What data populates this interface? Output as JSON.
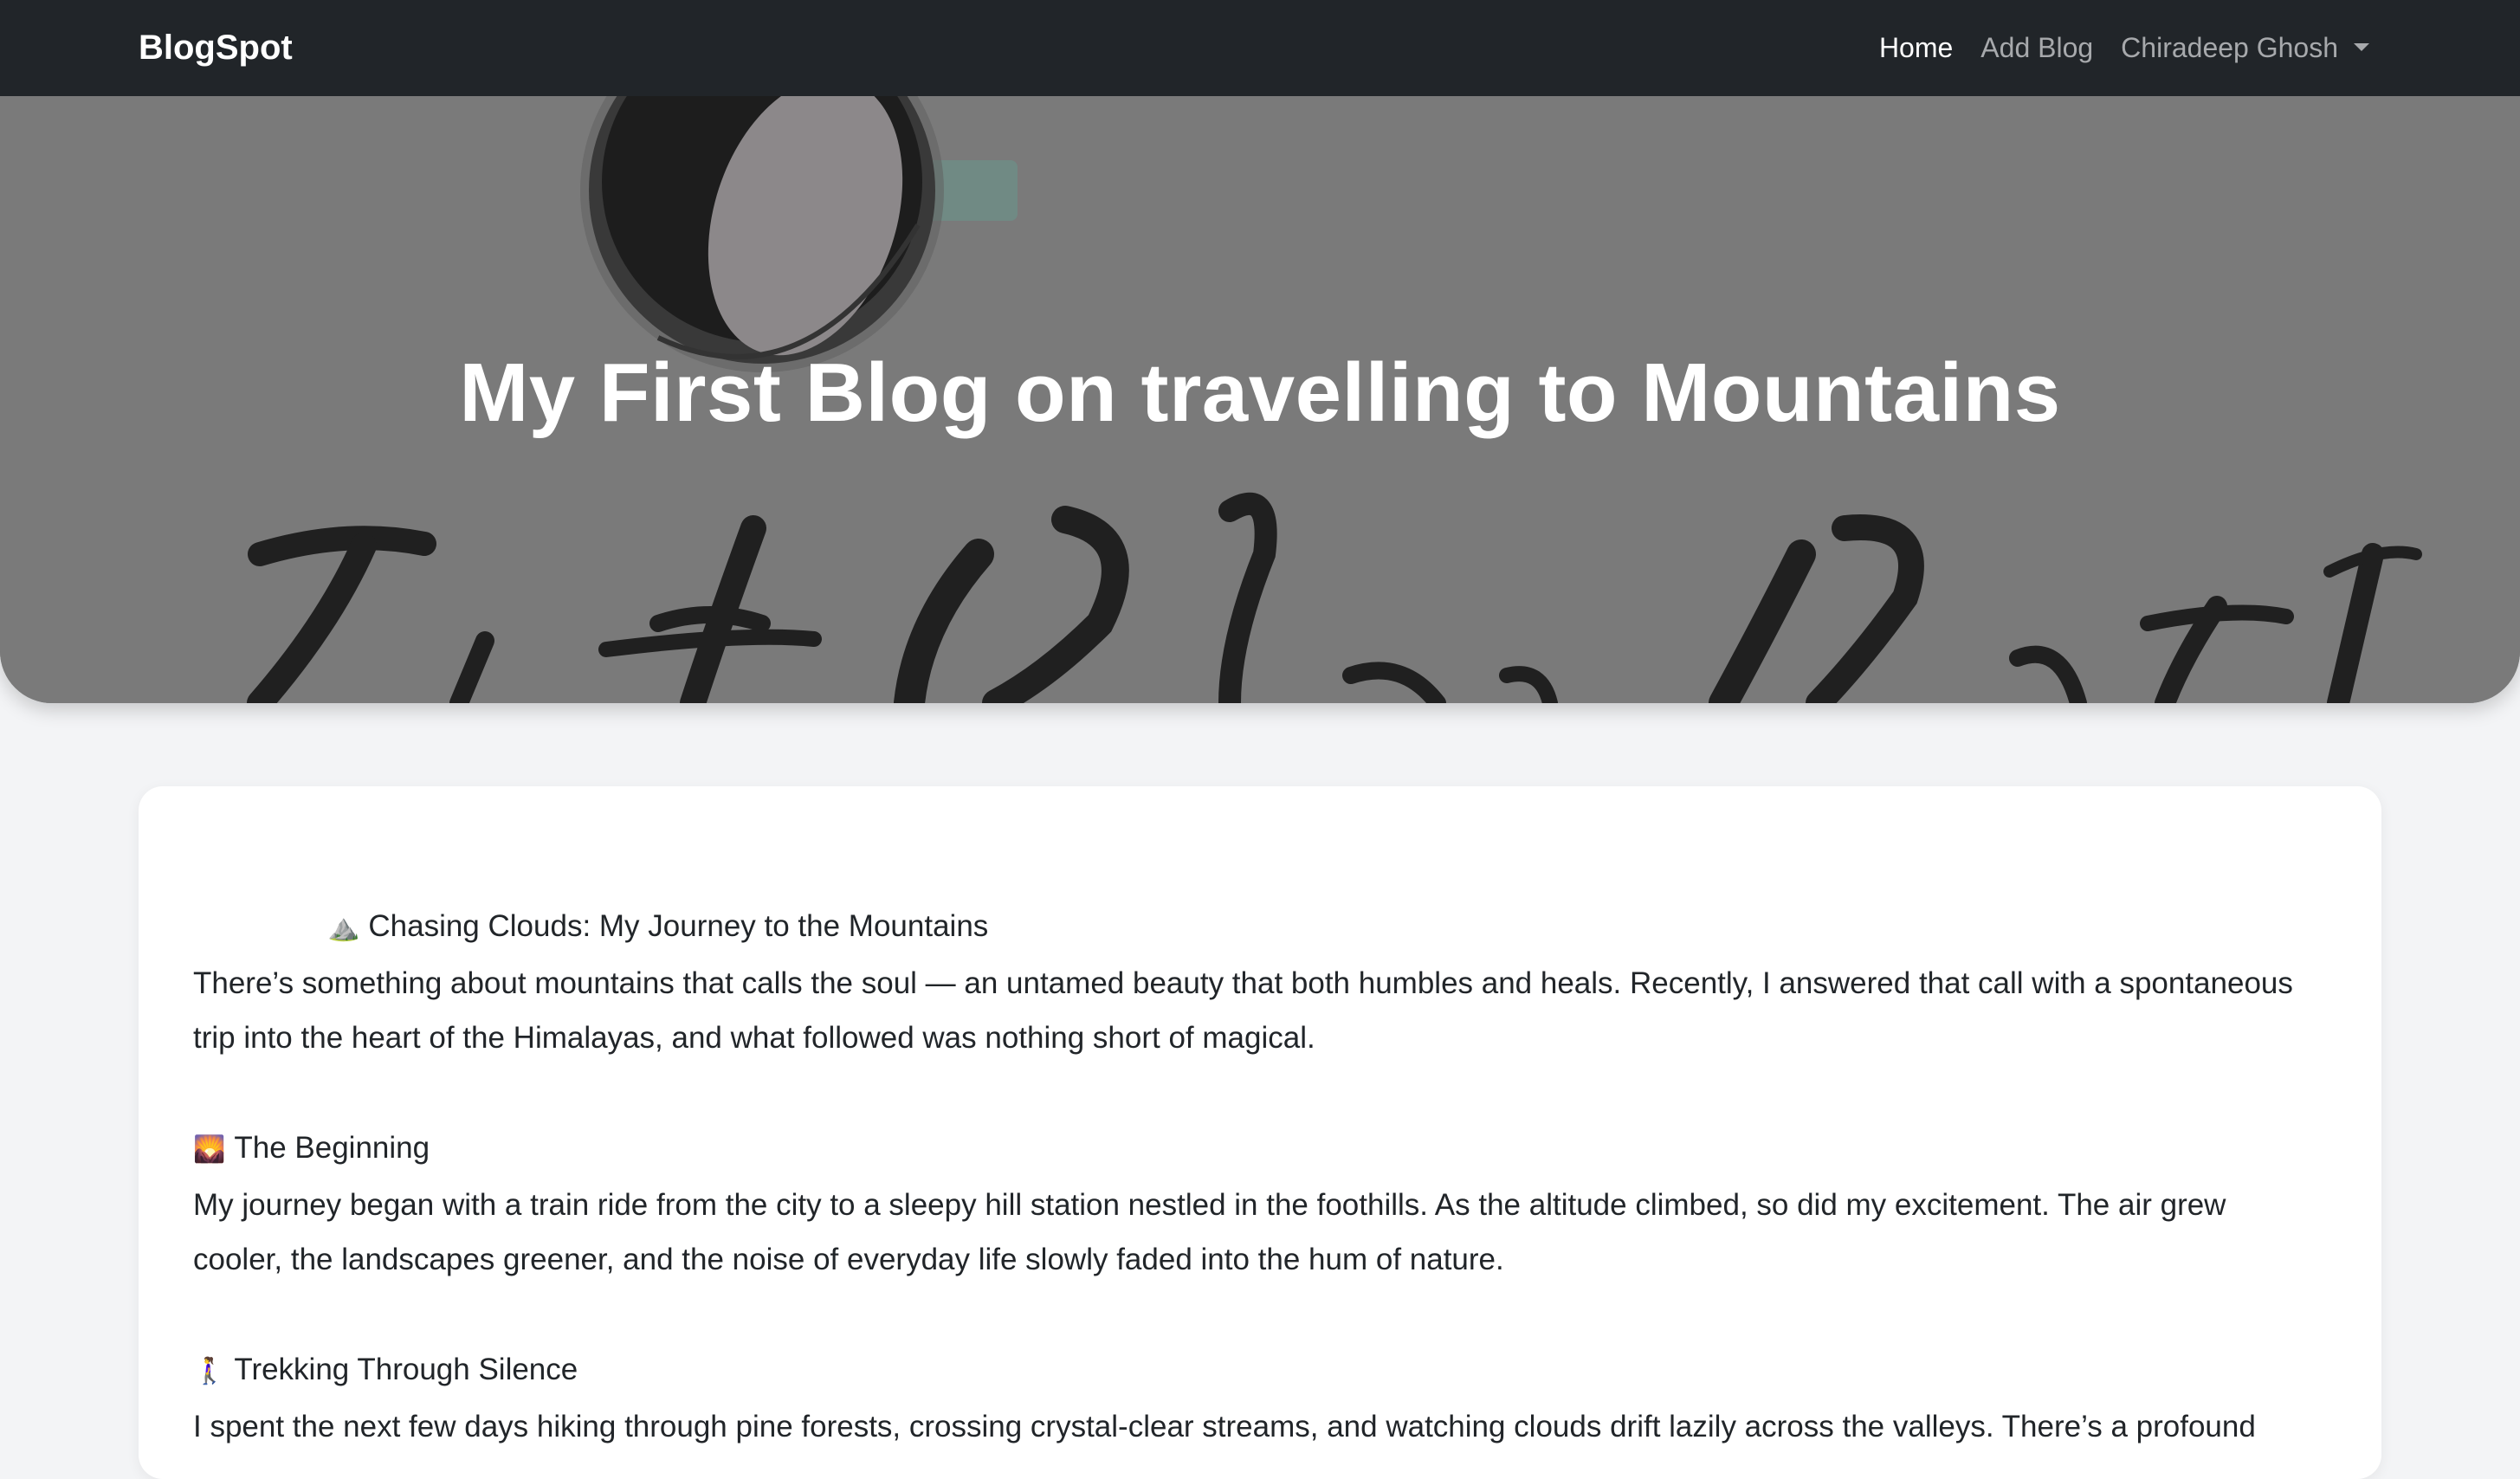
{
  "navbar": {
    "brand": "BlogSpot",
    "links": [
      {
        "label": "Home",
        "active": true
      },
      {
        "label": "Add Blog",
        "active": false
      }
    ],
    "user": {
      "label": "Chiradeep Ghosh"
    }
  },
  "hero": {
    "title": "My First Blog on travelling to Mountains"
  },
  "post": {
    "intro_heading": {
      "icon": "⛰️",
      "text": "Chasing Clouds: My Journey to the Mountains"
    },
    "intro_body": "There’s something about mountains that calls the soul — an untamed beauty that both humbles and heals. Recently, I answered that call with a spontaneous trip into the heart of the Himalayas, and what followed was nothing short of magical.",
    "section1_heading": {
      "icon": "🌄",
      "text": "The Beginning"
    },
    "section1_body": "My journey began with a train ride from the city to a sleepy hill station nestled in the foothills. As the altitude climbed, so did my excitement. The air grew cooler, the landscapes greener, and the noise of everyday life slowly faded into the hum of nature.",
    "section2_heading": {
      "icon": "🚶‍♀️",
      "text": "Trekking Through Silence"
    },
    "section2_body": "I spent the next few days hiking through pine forests, crossing crystal-clear streams, and watching clouds drift lazily across the valleys. There’s a profound"
  },
  "colors": {
    "navbar_bg": "#212529",
    "page_bg": "#f3f4f6",
    "hero_overlay": "#787878",
    "text": "#212529"
  }
}
